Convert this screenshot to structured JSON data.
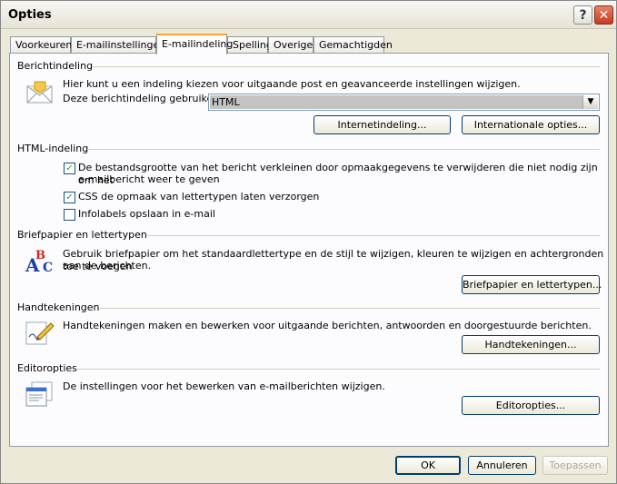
{
  "window": {
    "title": "Opties"
  },
  "tabs": [
    "Voorkeuren",
    "E-mailinstellingen",
    "E-mailindeling",
    "Spelling",
    "Overige",
    "Gemachtigden"
  ],
  "sections": {
    "message_format": {
      "label": "Berichtindeling",
      "description": "Hier kunt u een indeling kiezen voor uitgaande post en geavanceerde instellingen wijzigen.",
      "format_label": "Deze berichtindeling gebruiken:",
      "format_value": "HTML",
      "internet_button": "Internetindeling...",
      "international_button": "Internationale opties..."
    },
    "html_format": {
      "label": "HTML-indeling",
      "option1_line1": "De bestandsgrootte van het bericht verkleinen door opmaakgegevens te verwijderen die niet nodig zijn om het",
      "option1_line2": "e-mailbericht weer te geven",
      "option1_checked": true,
      "option2": "CSS de opmaak van lettertypen laten verzorgen",
      "option2_checked": true,
      "option3": "Infolabels opslaan in e-mail",
      "option3_checked": false
    },
    "stationery": {
      "label": "Briefpapier en lettertypen",
      "description_line1": "Gebruik briefpapier om het standaardlettertype en de stijl te wijzigen, kleuren te wijzigen en achtergronden toe te voegen",
      "description_line2": "aan de berichten.",
      "button": "Briefpapier en lettertypen..."
    },
    "signatures": {
      "label": "Handtekeningen",
      "description": "Handtekeningen maken en bewerken voor uitgaande berichten, antwoorden en doorgestuurde berichten.",
      "button": "Handtekeningen..."
    },
    "editor": {
      "label": "Editoropties",
      "description": "De instellingen voor het bewerken van e-mailberichten wijzigen.",
      "button": "Editoropties..."
    }
  },
  "footer": {
    "ok": "OK",
    "cancel": "Annuleren",
    "apply": "Toepassen"
  }
}
